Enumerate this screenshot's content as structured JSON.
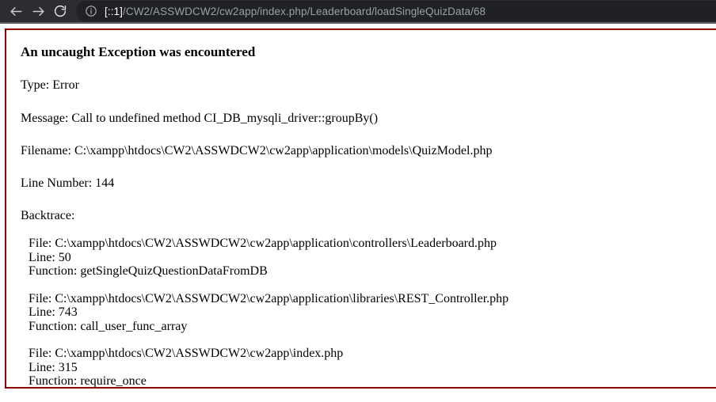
{
  "browser": {
    "back_label": "Back",
    "forward_label": "Forward",
    "reload_label": "Reload",
    "site_info_label": "View site information",
    "url_host": "[::1]",
    "url_path": "/CW2/ASSWDCW2/cw2app/index.php/Leaderboard/loadSingleQuizData/68",
    "toolbar_bg": "#2b2d31",
    "omnibox_bg": "#202124",
    "url_text_color": "#9aa0a6",
    "url_host_color": "#ffffff"
  },
  "error_page": {
    "border_color": "#8b0000",
    "title": "An uncaught Exception was encountered",
    "type_line": "Type: Error",
    "message_line": "Message: Call to undefined method CI_DB_mysqli_driver::groupBy()",
    "filename_line": "Filename: C:\\xampp\\htdocs\\CW2\\ASSWDCW2\\cw2app\\application\\models\\QuizModel.php",
    "line_number_line": "Line Number: 144",
    "backtrace_label": "Backtrace:",
    "backtrace": [
      {
        "file": "File: C:\\xampp\\htdocs\\CW2\\ASSWDCW2\\cw2app\\application\\controllers\\Leaderboard.php",
        "line": "Line: 50",
        "function": "Function: getSingleQuizQuestionDataFromDB"
      },
      {
        "file": "File: C:\\xampp\\htdocs\\CW2\\ASSWDCW2\\cw2app\\application\\libraries\\REST_Controller.php",
        "line": "Line: 743",
        "function": "Function: call_user_func_array"
      },
      {
        "file": "File: C:\\xampp\\htdocs\\CW2\\ASSWDCW2\\cw2app\\index.php",
        "line": "Line: 315",
        "function": "Function: require_once"
      }
    ]
  }
}
